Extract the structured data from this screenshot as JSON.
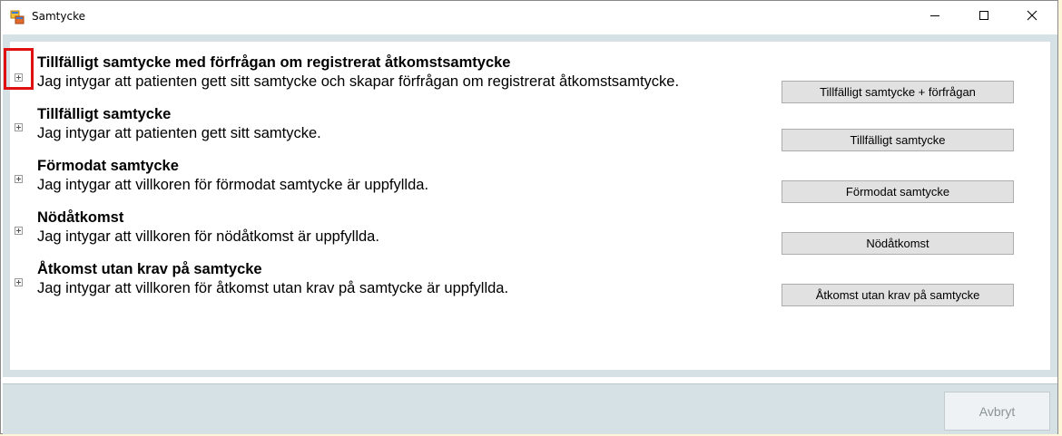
{
  "window": {
    "title": "Samtycke",
    "app_icon": "windows-form-icon",
    "controls": {
      "minimize": "minimize-icon",
      "maximize": "maximize-icon",
      "close": "close-icon"
    }
  },
  "options": [
    {
      "title": "Tillfälligt samtycke med förfrågan om registrerat åtkomstsamtycke",
      "description": "Jag intygar att patienten gett sitt samtycke och skapar förfrågan om registrerat åtkomstsamtycke.",
      "button": "Tillfälligt samtycke + förfrågan",
      "expanded": false
    },
    {
      "title": "Tillfälligt samtycke",
      "description": "Jag intygar att patienten gett sitt samtycke.",
      "button": "Tillfälligt samtycke",
      "expanded": false
    },
    {
      "title": "Förmodat samtycke",
      "description": "Jag intygar att villkoren för förmodat samtycke är uppfyllda.",
      "button": "Förmodat samtycke",
      "expanded": false
    },
    {
      "title": "Nödåtkomst",
      "description": "Jag intygar att villkoren för nödåtkomst är uppfyllda.",
      "button": "Nödåtkomst",
      "expanded": false
    },
    {
      "title": "Åtkomst utan krav på samtycke",
      "description": "Jag intygar att villkoren för åtkomst utan krav på samtycke är uppfyllda.",
      "button": "Åtkomst utan krav på samtycke",
      "expanded": false
    }
  ],
  "footer": {
    "cancel_label": "Avbryt",
    "cancel_enabled": false
  },
  "colors": {
    "highlight": "#e01010",
    "content_background": "#d5e1e5",
    "button_face": "#e1e1e1"
  }
}
